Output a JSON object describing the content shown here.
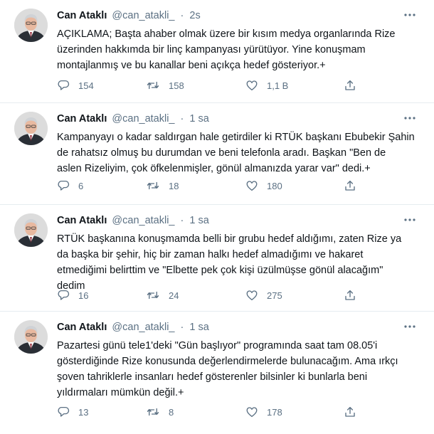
{
  "tweets": [
    {
      "name": "Can Ataklı",
      "handle": "@can_atakli_",
      "dot": "·",
      "time": "2s",
      "text": "AÇIKLAMA; Başta ahaber olmak üzere bir kısım medya organlarında Rize\nüzerinden hakkımda bir linç kampanyası yürütüyor. Yine konuşmam\nmontajlanmış ve bu kanallar beni açıkça hedef gösteriyor.+",
      "replies": "154",
      "retweets": "158",
      "likes": "1,1 B"
    },
    {
      "name": "Can Ataklı",
      "handle": "@can_atakli_",
      "dot": "·",
      "time": "1 sa",
      "text": "Kampanyayı o kadar saldırgan hale getirdiler ki RTÜK başkanı Ebubekir Şahin\nde rahatsız olmuş bu durumdan ve beni telefonla aradı. Başkan \"Ben de\naslen Rizeliyim, çok öfkelenmişler, gönül almanızda yarar var\" dedi.+",
      "replies": "6",
      "retweets": "18",
      "likes": "180"
    },
    {
      "name": "Can Ataklı",
      "handle": "@can_atakli_",
      "dot": "·",
      "time": "1 sa",
      "text": "RTÜK başkanına konuşmamda belli bir grubu hedef aldığımı, zaten Rize ya\nda başka bir şehir, hiç bir zaman halkı hedef almadığımı ve hakaret\netmediğimi belirttim ve \"Elbette pek çok kişi üzülmüşse gönül alacağım\"\ndedim",
      "replies": "16",
      "retweets": "24",
      "likes": "275"
    },
    {
      "name": "Can Ataklı",
      "handle": "@can_atakli_",
      "dot": "·",
      "time": "1 sa",
      "text": "Pazartesi günü tele1'deki \"Gün başlıyor\" programında saat tam 08.05'i\ngösterdiğinde Rize konusunda değerlendirmelerde bulunacağım. Ama ırkçı\nşoven tahriklerle insanları hedef gösterenler bilsinler ki bunlarla beni\nyıldırmaları mümkün değil.+",
      "replies": "13",
      "retweets": "8",
      "likes": "178"
    }
  ],
  "colors": {
    "text": "#0f1419",
    "secondary": "#5b7083",
    "divider": "#e6ecf0"
  },
  "icons": [
    "more-icon",
    "reply-icon",
    "retweet-icon",
    "like-icon",
    "share-icon"
  ]
}
